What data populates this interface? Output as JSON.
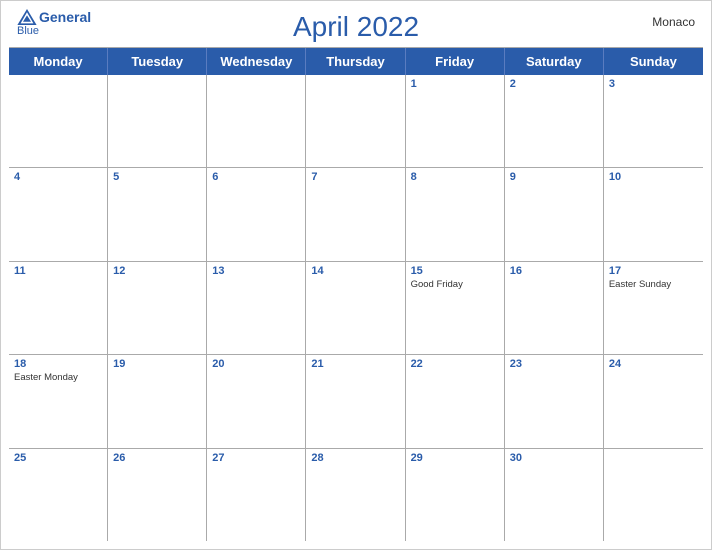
{
  "brand": {
    "name_line1": "General",
    "name_line2": "Blue"
  },
  "title": "April 2022",
  "region": "Monaco",
  "day_headers": [
    "Monday",
    "Tuesday",
    "Wednesday",
    "Thursday",
    "Friday",
    "Saturday",
    "Sunday"
  ],
  "weeks": [
    [
      {
        "date": "",
        "events": []
      },
      {
        "date": "",
        "events": []
      },
      {
        "date": "",
        "events": []
      },
      {
        "date": "",
        "events": []
      },
      {
        "date": "1",
        "events": []
      },
      {
        "date": "2",
        "events": []
      },
      {
        "date": "3",
        "events": []
      }
    ],
    [
      {
        "date": "4",
        "events": []
      },
      {
        "date": "5",
        "events": []
      },
      {
        "date": "6",
        "events": []
      },
      {
        "date": "7",
        "events": []
      },
      {
        "date": "8",
        "events": []
      },
      {
        "date": "9",
        "events": []
      },
      {
        "date": "10",
        "events": []
      }
    ],
    [
      {
        "date": "11",
        "events": []
      },
      {
        "date": "12",
        "events": []
      },
      {
        "date": "13",
        "events": []
      },
      {
        "date": "14",
        "events": []
      },
      {
        "date": "15",
        "events": [
          "Good Friday"
        ]
      },
      {
        "date": "16",
        "events": []
      },
      {
        "date": "17",
        "events": [
          "Easter Sunday"
        ]
      }
    ],
    [
      {
        "date": "18",
        "events": [
          "Easter Monday"
        ]
      },
      {
        "date": "19",
        "events": []
      },
      {
        "date": "20",
        "events": []
      },
      {
        "date": "21",
        "events": []
      },
      {
        "date": "22",
        "events": []
      },
      {
        "date": "23",
        "events": []
      },
      {
        "date": "24",
        "events": []
      }
    ],
    [
      {
        "date": "25",
        "events": []
      },
      {
        "date": "26",
        "events": []
      },
      {
        "date": "27",
        "events": []
      },
      {
        "date": "28",
        "events": []
      },
      {
        "date": "29",
        "events": []
      },
      {
        "date": "30",
        "events": []
      },
      {
        "date": "",
        "events": []
      }
    ]
  ]
}
